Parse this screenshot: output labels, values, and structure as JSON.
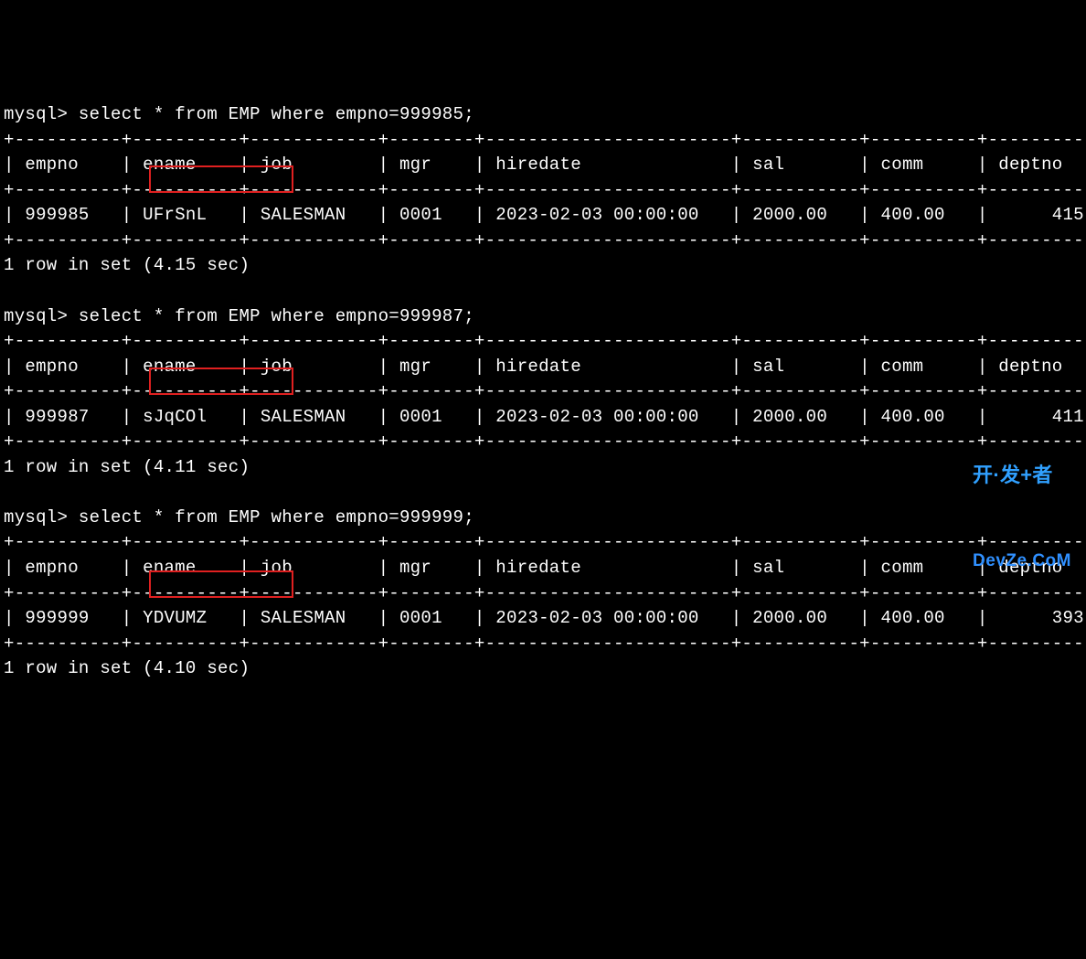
{
  "prompt": "mysql>",
  "columns": [
    "empno",
    "ename",
    "job",
    "mgr",
    "hiredate",
    "sal",
    "comm",
    "deptno"
  ],
  "queries": [
    {
      "sql": "select * from EMP where empno=999985;",
      "row": {
        "empno": "999985",
        "ename": "UFrSnL",
        "job": "SALESMAN",
        "mgr": "0001",
        "hiredate": "2023-02-03 00:00:00",
        "sal": "2000.00",
        "comm": "400.00",
        "deptno": "415"
      },
      "result_text": "1 row in set",
      "timing": "(4.15 sec)"
    },
    {
      "sql": "select * from EMP where empno=999987;",
      "row": {
        "empno": "999987",
        "ename": "sJqCOl",
        "job": "SALESMAN",
        "mgr": "0001",
        "hiredate": "2023-02-03 00:00:00",
        "sal": "2000.00",
        "comm": "400.00",
        "deptno": "411"
      },
      "result_text": "1 row in set",
      "timing": "(4.11 sec)"
    },
    {
      "sql": "select * from EMP where empno=999999;",
      "row": {
        "empno": "999999",
        "ename": "YDVUMZ",
        "job": "SALESMAN",
        "mgr": "0001",
        "hiredate": "2023-02-03 00:00:00",
        "sal": "2000.00",
        "comm": "400.00",
        "deptno": "393"
      },
      "result_text": "1 row in set",
      "timing": "(4.10 sec)"
    }
  ],
  "highlight_color": "#e02020",
  "watermark": {
    "line1": "开·发+者",
    "line2": "DevZe.CoM"
  }
}
